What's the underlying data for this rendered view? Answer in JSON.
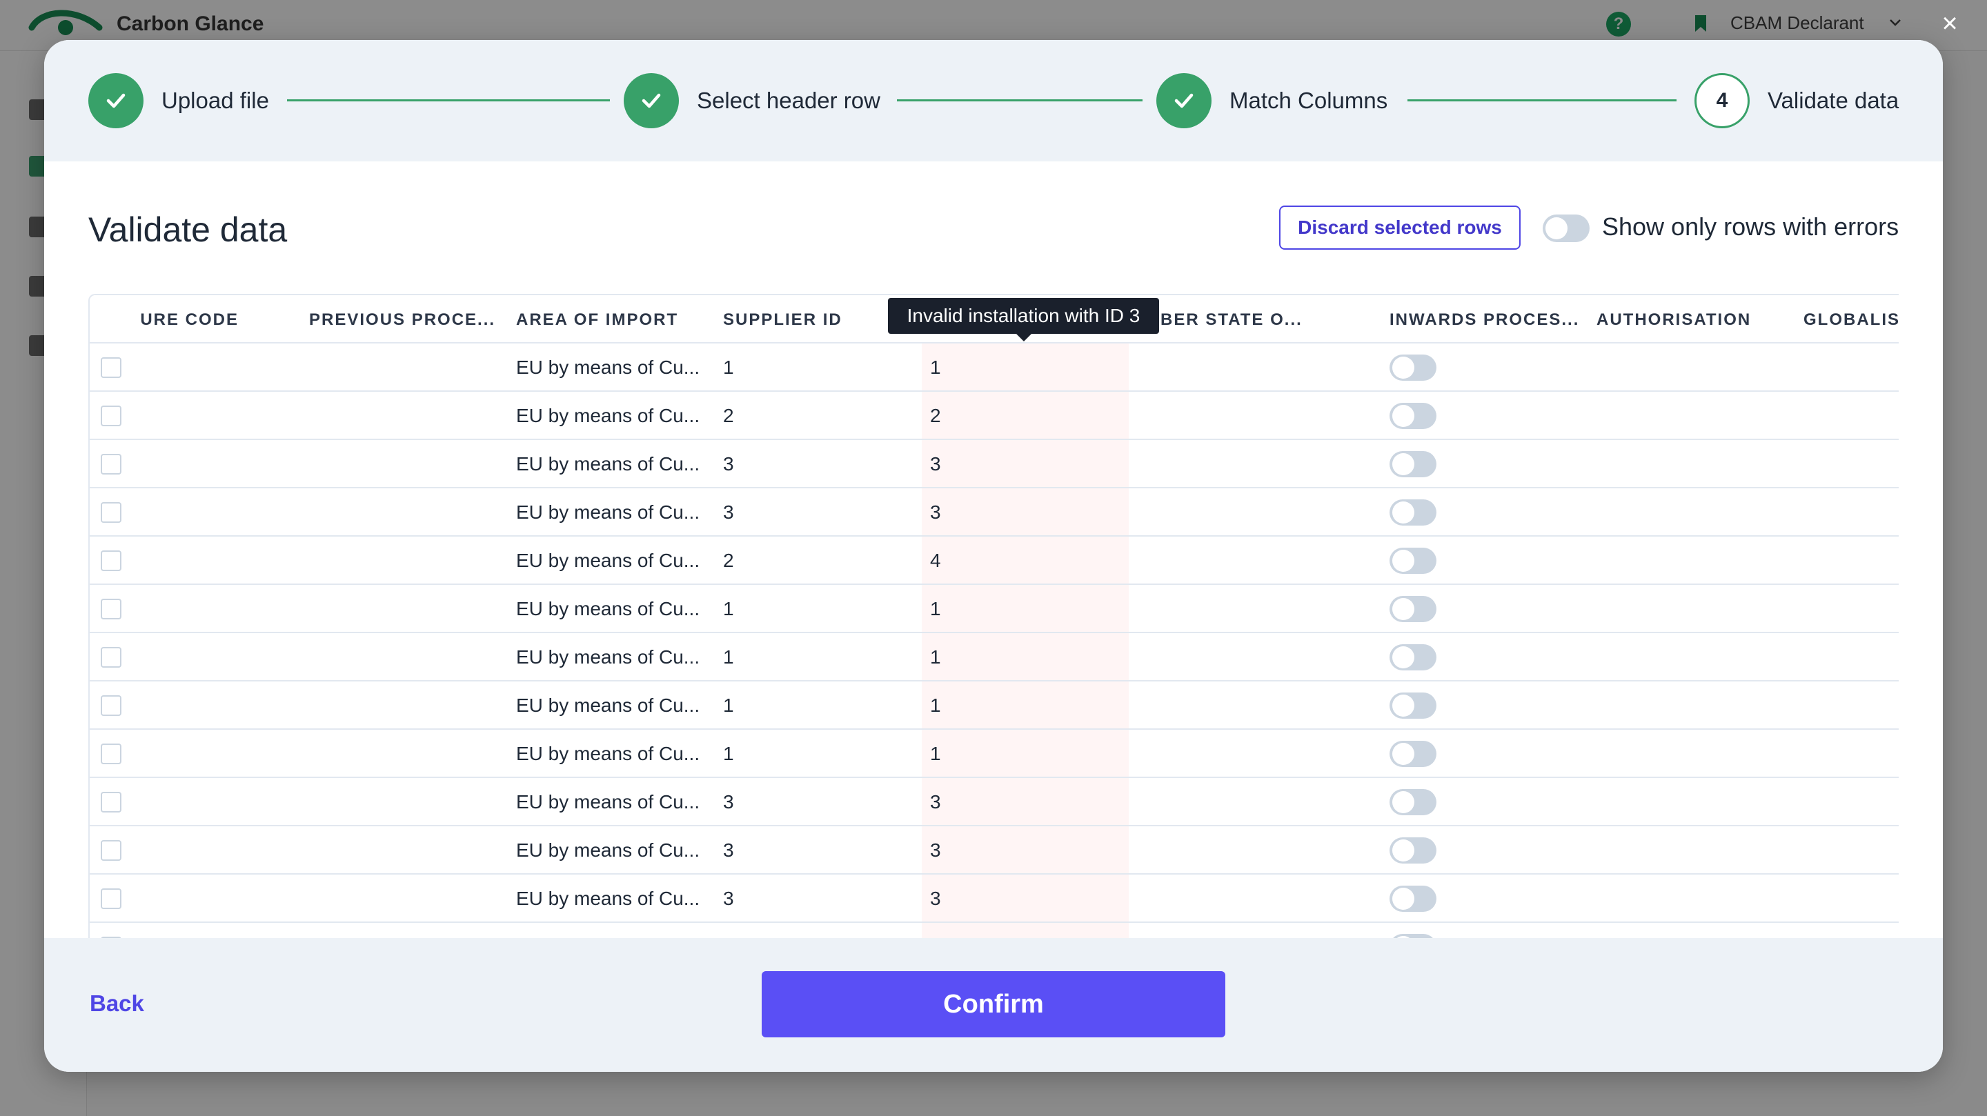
{
  "app": {
    "brand": "Carbon Glance",
    "help_icon": "?",
    "account": "CBAM Declarant",
    "close_glyph": "×"
  },
  "steps": [
    {
      "label": "Upload file",
      "status": "done"
    },
    {
      "label": "Select header row",
      "status": "done"
    },
    {
      "label": "Match Columns",
      "status": "done"
    },
    {
      "label": "Validate data",
      "status": "current",
      "number": "4"
    }
  ],
  "page": {
    "title": "Validate data",
    "discard_label": "Discard selected rows",
    "filter_label": "Show only rows with errors"
  },
  "table": {
    "columns": [
      "PROCEDURE CODE",
      "PREVIOUS PROCE...",
      "AREA OF IMPORT",
      "SUPPLIER ID",
      "",
      "MEMBER STATE O...",
      "INWARDS PROCES...",
      "AUTHORISATION",
      "GLOBALISATION"
    ],
    "rows": [
      {
        "area": "EU by means of Cu...",
        "supplier": "1",
        "installation": "1"
      },
      {
        "area": "EU by means of Cu...",
        "supplier": "2",
        "installation": "2"
      },
      {
        "area": "EU by means of Cu...",
        "supplier": "3",
        "installation": "3"
      },
      {
        "area": "EU by means of Cu...",
        "supplier": "3",
        "installation": "3"
      },
      {
        "area": "EU by means of Cu...",
        "supplier": "2",
        "installation": "4"
      },
      {
        "area": "EU by means of Cu...",
        "supplier": "1",
        "installation": "1"
      },
      {
        "area": "EU by means of Cu...",
        "supplier": "1",
        "installation": "1"
      },
      {
        "area": "EU by means of Cu...",
        "supplier": "1",
        "installation": "1"
      },
      {
        "area": "EU by means of Cu...",
        "supplier": "1",
        "installation": "1"
      },
      {
        "area": "EU by means of Cu...",
        "supplier": "3",
        "installation": "3"
      },
      {
        "area": "EU by means of Cu...",
        "supplier": "3",
        "installation": "3"
      },
      {
        "area": "EU by means of Cu...",
        "supplier": "3",
        "installation": "3"
      }
    ]
  },
  "tooltip": "Invalid installation with ID 3",
  "footer": {
    "back_label": "Back",
    "confirm_label": "Confirm"
  },
  "colors": {
    "accent": "#5a4ff5",
    "success": "#38a169",
    "error_cell_bg": "#fff5f5"
  }
}
